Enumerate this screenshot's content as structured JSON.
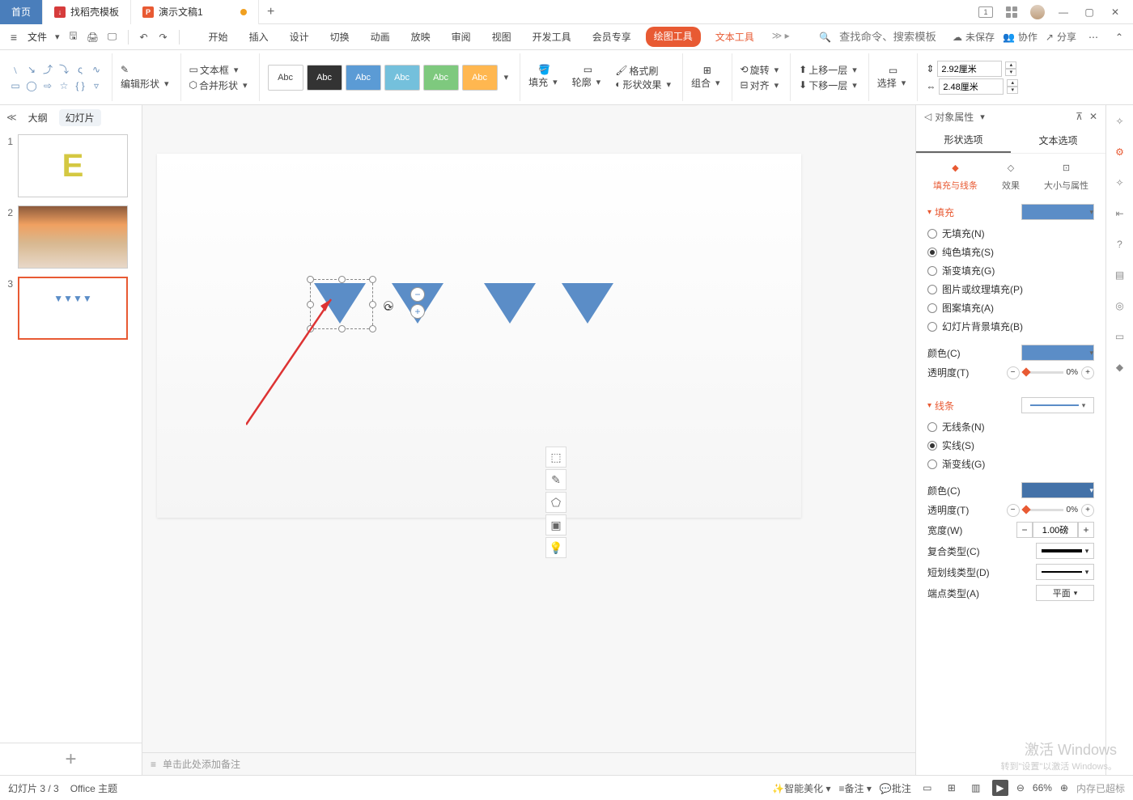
{
  "tabs": {
    "home": "首页",
    "template": "找稻壳模板",
    "doc": "演示文稿1"
  },
  "menu": {
    "file": "文件"
  },
  "ribbonTabs": [
    "开始",
    "插入",
    "设计",
    "切换",
    "动画",
    "放映",
    "审阅",
    "视图",
    "开发工具",
    "会员专享"
  ],
  "ribbon": {
    "drawing": "绘图工具",
    "text": "文本工具"
  },
  "search": {
    "placeholder": "查找命令、搜索模板"
  },
  "topRight": {
    "unsaved": "未保存",
    "collab": "协作",
    "share": "分享"
  },
  "toolbar": {
    "editShape": "编辑形状",
    "mergeShape": "合并形状",
    "textbox": "文本框",
    "swatch": "Abc",
    "fill": "填充",
    "outline": "轮廓",
    "effect": "形状效果",
    "formatBrush": "格式刷",
    "group": "组合",
    "rotate": "旋转",
    "align": "对齐",
    "moveUp": "上移一层",
    "moveDown": "下移一层",
    "select": "选择",
    "width": "2.92厘米",
    "height": "2.48厘米"
  },
  "panel": {
    "outline": "大纲",
    "slides": "幻灯片"
  },
  "notes": {
    "placeholder": "单击此处添加备注"
  },
  "prop": {
    "title": "对象属性",
    "shapeOpt": "形状选项",
    "textOpt": "文本选项",
    "fillLine": "填充与线条",
    "effects": "效果",
    "sizeProp": "大小与属性",
    "fill": "填充",
    "noFill": "无填充(N)",
    "solidFill": "纯色填充(S)",
    "gradFill": "渐变填充(G)",
    "picFill": "图片或纹理填充(P)",
    "patFill": "图案填充(A)",
    "bgFill": "幻灯片背景填充(B)",
    "color": "颜色(C)",
    "opacity": "透明度(T)",
    "opacityVal": "0%",
    "line": "线条",
    "noLine": "无线条(N)",
    "solidLine": "实线(S)",
    "gradLine": "渐变线(G)",
    "lineColor": "颜色(C)",
    "lineWidth": "宽度(W)",
    "lineWidthVal": "1.00磅",
    "compound": "复合类型(C)",
    "dash": "短划线类型(D)",
    "cap": "端点类型(A)",
    "capVal": "平面"
  },
  "status": {
    "slide": "幻灯片 3 / 3",
    "theme": "Office 主题",
    "beautify": "智能美化",
    "notes": "备注",
    "comment": "批注",
    "zoom": "66%",
    "mem": "内存已超标"
  },
  "watermark": {
    "main": "激活 Windows",
    "sub": "转到\"设置\"以激活 Windows。"
  }
}
